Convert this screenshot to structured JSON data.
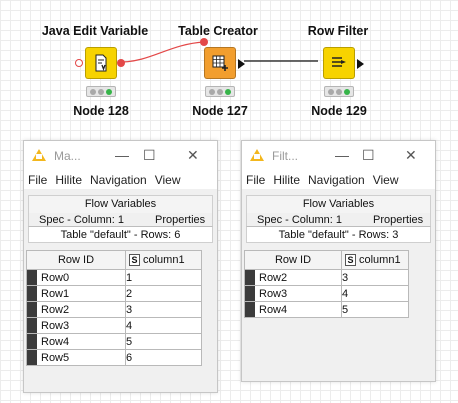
{
  "workflow": {
    "nodes": [
      {
        "title": "Java Edit Variable",
        "label": "Node 128",
        "icon": "java-edit-variable-icon",
        "color": "#f7d300",
        "status": [
          "off",
          "off",
          "green"
        ]
      },
      {
        "title": "Table Creator",
        "label": "Node 127",
        "icon": "table-creator-icon",
        "color": "#f29e2e",
        "status": [
          "off",
          "off",
          "green"
        ]
      },
      {
        "title": "Row Filter",
        "label": "Node 129",
        "icon": "row-filter-icon",
        "color": "#f7d300",
        "status": [
          "off",
          "off",
          "green"
        ]
      }
    ],
    "connections": [
      {
        "from": "Node 128",
        "to": "Node 127",
        "type": "flow-variable",
        "color": "#e34848"
      },
      {
        "from": "Node 127",
        "to": "Node 129",
        "type": "data",
        "color": "#111111"
      }
    ]
  },
  "windows": [
    {
      "title": "Ma...",
      "controls": {
        "minimize": "—",
        "maximize": "☐",
        "close": "✕"
      },
      "menu": [
        "File",
        "Hilite",
        "Navigation",
        "View"
      ],
      "flow_variables_label": "Flow Variables",
      "tabs": [
        "Spec - Column: 1",
        "Properties"
      ],
      "rows_info": "Table \"default\" - Rows: 6",
      "table": {
        "headers": [
          "Row ID",
          "column1"
        ],
        "type_badge": "S",
        "rows": [
          {
            "id": "Row0",
            "value": "1"
          },
          {
            "id": "Row1",
            "value": "2"
          },
          {
            "id": "Row2",
            "value": "3"
          },
          {
            "id": "Row3",
            "value": "4"
          },
          {
            "id": "Row4",
            "value": "5"
          },
          {
            "id": "Row5",
            "value": "6"
          }
        ]
      }
    },
    {
      "title": "Filt...",
      "controls": {
        "minimize": "—",
        "maximize": "☐",
        "close": "✕"
      },
      "menu": [
        "File",
        "Hilite",
        "Navigation",
        "View"
      ],
      "flow_variables_label": "Flow Variables",
      "tabs": [
        "Spec - Column: 1",
        "Properties"
      ],
      "rows_info": "Table \"default\" - Rows: 3",
      "table": {
        "headers": [
          "Row ID",
          "column1"
        ],
        "type_badge": "S",
        "rows": [
          {
            "id": "Row2",
            "value": "3"
          },
          {
            "id": "Row3",
            "value": "4"
          },
          {
            "id": "Row4",
            "value": "5"
          }
        ]
      }
    }
  ]
}
